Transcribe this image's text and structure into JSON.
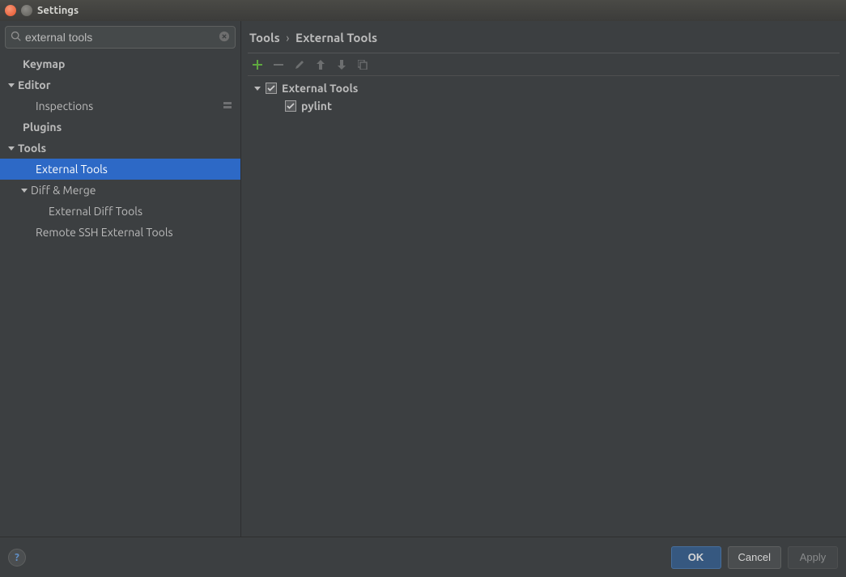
{
  "titlebar": {
    "title": "Settings"
  },
  "search": {
    "value": "external tools"
  },
  "sidebar": {
    "items": [
      {
        "label": "Keymap"
      },
      {
        "label": "Editor"
      },
      {
        "label": "Inspections"
      },
      {
        "label": "Plugins"
      },
      {
        "label": "Tools"
      },
      {
        "label": "External Tools"
      },
      {
        "label": "Diff & Merge"
      },
      {
        "label": "External Diff Tools"
      },
      {
        "label": "Remote SSH External Tools"
      }
    ]
  },
  "breadcrumb": {
    "parent": "Tools",
    "sep": "›",
    "child": "External Tools"
  },
  "content_tree": {
    "group": {
      "label": "External Tools"
    },
    "item": {
      "label": "pylint"
    }
  },
  "footer": {
    "help": "?",
    "ok": "OK",
    "cancel": "Cancel",
    "apply": "Apply"
  }
}
